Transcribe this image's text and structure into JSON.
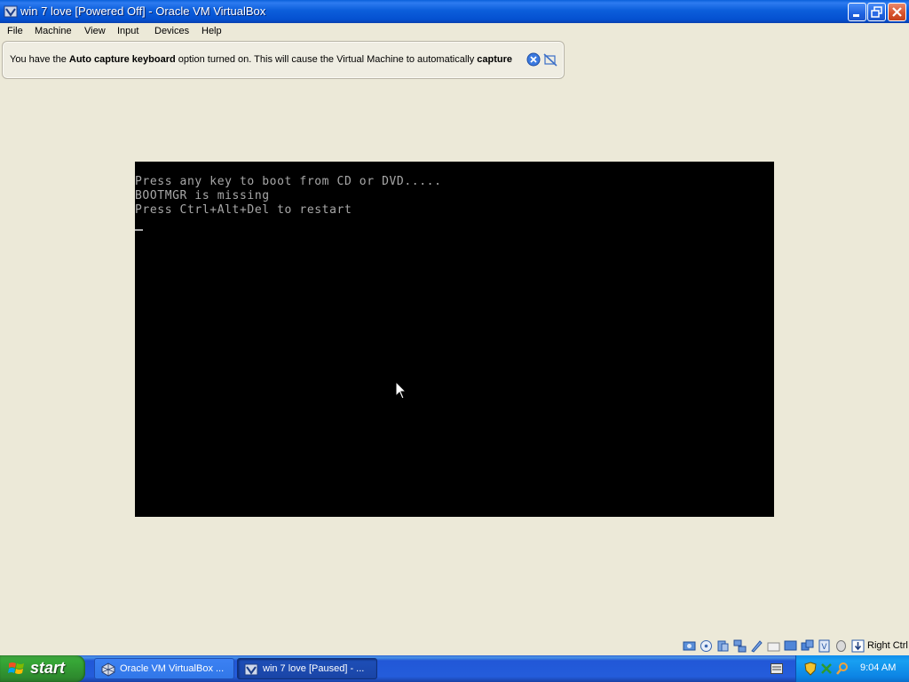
{
  "window": {
    "title": "win 7 love [Powered Off] - Oracle VM VirtualBox",
    "minimize_icon": "minimize-icon",
    "restore_icon": "restore-icon",
    "close_icon": "close-icon"
  },
  "menu": {
    "items": [
      "File",
      "Machine",
      "View",
      "Input",
      "Devices",
      "Help"
    ]
  },
  "notification": {
    "part1": "You have the ",
    "bold1": "Auto capture keyboard",
    "part2": " option turned on. This will cause the Virtual Machine to automatically ",
    "bold2": "capture"
  },
  "vm_screen": {
    "lines": [
      "Press any key to boot from CD or DVD.....",
      "BOOTMGR is missing",
      "Press Ctrl+Alt+Del to restart"
    ]
  },
  "statusbar": {
    "host_key": "Right Ctrl",
    "icons": [
      "hard-disk-icon",
      "optical-drive-icon",
      "audio-icon",
      "network-icon",
      "usb-icon",
      "shared-folders-icon",
      "display-icon",
      "video-capture-icon",
      "virtualization-icon",
      "mouse-integration-icon",
      "keyboard-capture-icon"
    ]
  },
  "taskbar": {
    "start_label": "start",
    "tasks": [
      {
        "label": "Oracle VM VirtualBox ...",
        "active": false
      },
      {
        "label": "win 7 love [Paused] - ...",
        "active": true
      }
    ],
    "clock": "9:04 AM"
  },
  "colors": {
    "titlebar_blue": "#0C5EDB",
    "vm_text": "#A8A8A8",
    "taskbar_blue": "#245DDB",
    "start_green": "#37A837",
    "tray_blue": "#18A0F2"
  }
}
